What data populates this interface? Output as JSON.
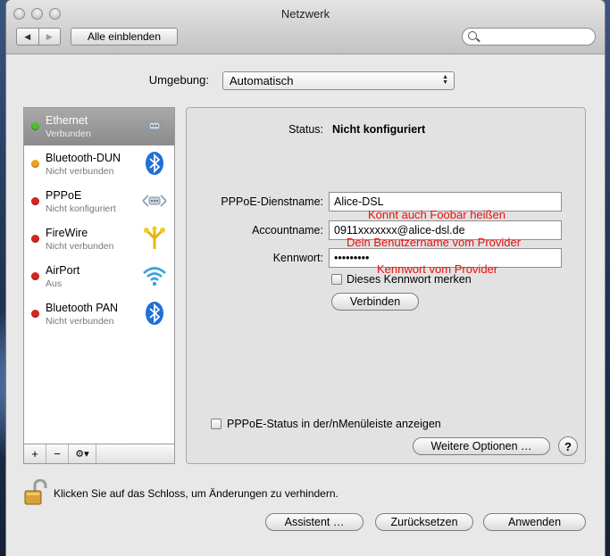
{
  "window": {
    "title": "Netzwerk"
  },
  "toolbar": {
    "back_icon": "chevron-left-icon",
    "forward_icon": "chevron-right-icon",
    "show_all_label": "Alle einblenden",
    "search_placeholder": ""
  },
  "location": {
    "label": "Umgebung:",
    "value": "Automatisch"
  },
  "services": [
    {
      "name": "Ethernet",
      "status": "Verbunden",
      "dot": "#4fbf2c",
      "icon": "ethernet-icon",
      "selected": true
    },
    {
      "name": "Bluetooth-DUN",
      "status": "Nicht verbunden",
      "dot": "#f0a21a",
      "icon": "bluetooth-icon"
    },
    {
      "name": "PPPoE",
      "status": "Nicht konfiguriert",
      "dot": "#d8241c",
      "icon": "ethernet-icon"
    },
    {
      "name": "FireWire",
      "status": "Nicht verbunden",
      "dot": "#d8241c",
      "icon": "firewire-icon"
    },
    {
      "name": "AirPort",
      "status": "Aus",
      "dot": "#d8241c",
      "icon": "wifi-icon"
    },
    {
      "name": "Bluetooth PAN",
      "status": "Nicht verbunden",
      "dot": "#d8241c",
      "icon": "bluetooth-icon"
    }
  ],
  "sidebar_footer": {
    "add": "+",
    "remove": "−",
    "gear": "⚙▾"
  },
  "detail": {
    "status_label": "Status:",
    "status_value": "Nicht konfiguriert",
    "service_name_label": "PPPoE-Dienstname:",
    "service_name_value": "Alice-DSL",
    "account_label": "Accountname:",
    "account_value": "0911xxxxxxx@alice-dsl.de",
    "password_label": "Kennwort:",
    "password_value": "•••••••••",
    "remember_label": "Dieses Kennwort merken",
    "connect_label": "Verbinden",
    "menubar_label": "PPPoE-Status in der/nMenüleiste anzeigen",
    "more_options_label": "Weitere Optionen …",
    "help_label": "?"
  },
  "annotations": {
    "service_name_note": "Könnt auch Foobar heißen",
    "account_note": "Dein Benutzername vom Provider",
    "password_note": "Kennwort vom Provider"
  },
  "footer": {
    "lock_text": "Klicken Sie auf das Schloss, um Änderungen zu verhindern.",
    "assistant_label": "Assistent …",
    "reset_label": "Zurücksetzen",
    "apply_label": "Anwenden"
  },
  "colors": {
    "annotation": "#e8100c",
    "selection": "#999999"
  }
}
